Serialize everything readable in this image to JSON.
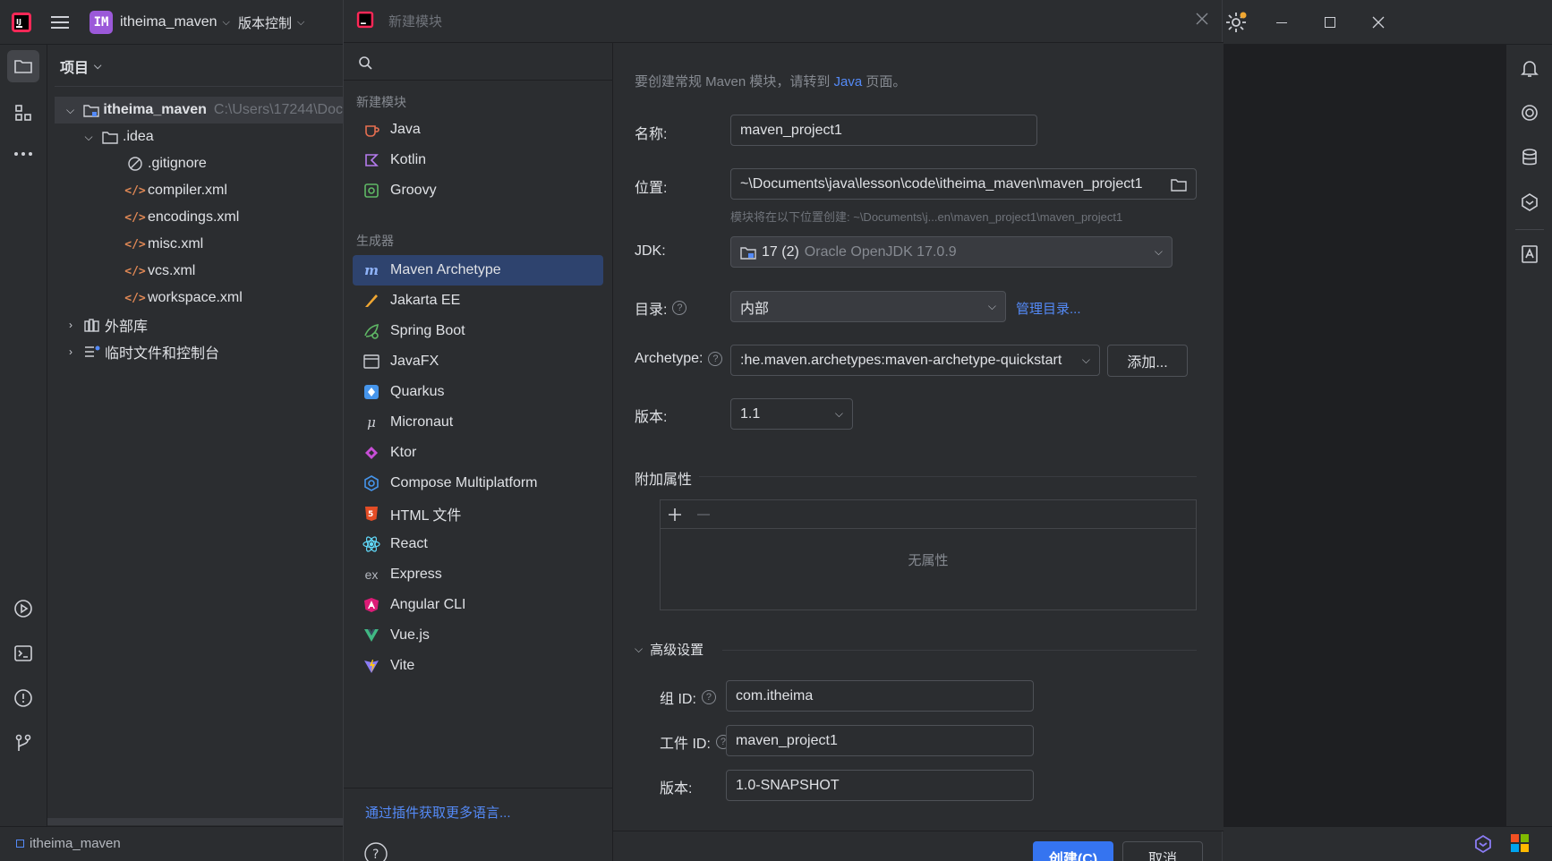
{
  "titlebar": {
    "project_badge": "IM",
    "project_name": "itheima_maven",
    "vcs_label": "版本控制"
  },
  "project_panel": {
    "header": "项目",
    "tree": [
      {
        "label": "itheima_maven",
        "hint": "C:\\Users\\17244\\Doc",
        "icon": "module-folder-icon",
        "depth": 0,
        "expanded": true
      },
      {
        "label": ".idea",
        "icon": "folder-icon",
        "depth": 1,
        "expanded": true
      },
      {
        "label": ".gitignore",
        "icon": "ignore-file-icon",
        "depth": 2
      },
      {
        "label": "compiler.xml",
        "icon": "xml-file-icon",
        "depth": 2
      },
      {
        "label": "encodings.xml",
        "icon": "xml-file-icon",
        "depth": 2
      },
      {
        "label": "misc.xml",
        "icon": "xml-file-icon",
        "depth": 2
      },
      {
        "label": "vcs.xml",
        "icon": "xml-file-icon",
        "depth": 2
      },
      {
        "label": "workspace.xml",
        "icon": "xml-file-icon",
        "depth": 2
      },
      {
        "label": "外部库",
        "icon": "library-icon",
        "depth": 0,
        "expanded": false
      },
      {
        "label": "临时文件和控制台",
        "icon": "scratch-icon",
        "depth": 0,
        "expanded": false
      }
    ]
  },
  "statusbar": {
    "project": "itheima_maven"
  },
  "dialog": {
    "title": "新建模块",
    "new_module_label": "新建模块",
    "languages": [
      "Java",
      "Kotlin",
      "Groovy"
    ],
    "generators_label": "生成器",
    "generators": [
      "Maven Archetype",
      "Jakarta EE",
      "Spring Boot",
      "JavaFX",
      "Quarkus",
      "Micronaut",
      "Ktor",
      "Compose Multiplatform",
      "HTML 文件",
      "React",
      "Express",
      "Angular CLI",
      "Vue.js",
      "Vite"
    ],
    "selected_generator": "Maven Archetype",
    "plugins_link": "通过插件获取更多语言...",
    "hint_prefix": "要创建常规 Maven 模块，请转到",
    "hint_link": "Java",
    "hint_suffix": "页面。",
    "name_label": "名称:",
    "name_value": "maven_project1",
    "location_label": "位置:",
    "location_value": "~\\Documents\\java\\lesson\\code\\itheima_maven\\maven_project1",
    "location_hint": "模块将在以下位置创建: ~\\Documents\\j...en\\maven_project1\\maven_project1",
    "jdk_label": "JDK:",
    "jdk_version": "17 (2)",
    "jdk_name": "Oracle OpenJDK 17.0.9",
    "catalog_label": "目录:",
    "catalog_value": "内部",
    "catalog_link": "管理目录...",
    "archetype_label": "Archetype:",
    "archetype_value": ":he.maven.archetypes:maven-archetype-quickstart",
    "add_button": "添加...",
    "version_label": "版本:",
    "version_value": "1.1",
    "extra_props_label": "附加属性",
    "no_props": "无属性",
    "advanced_label": "高级设置",
    "group_id_label": "组 ID:",
    "group_id_value": "com.itheima",
    "artifact_id_label": "工件 ID:",
    "artifact_id_value": "maven_project1",
    "adv_version_label": "版本:",
    "adv_version_value": "1.0-SNAPSHOT",
    "create_button": "创建(C)",
    "cancel_button": "取消"
  },
  "colors": {
    "accent": "#3574f0",
    "selection": "#2e436e",
    "link": "#548af7",
    "background": "#2b2d30"
  }
}
